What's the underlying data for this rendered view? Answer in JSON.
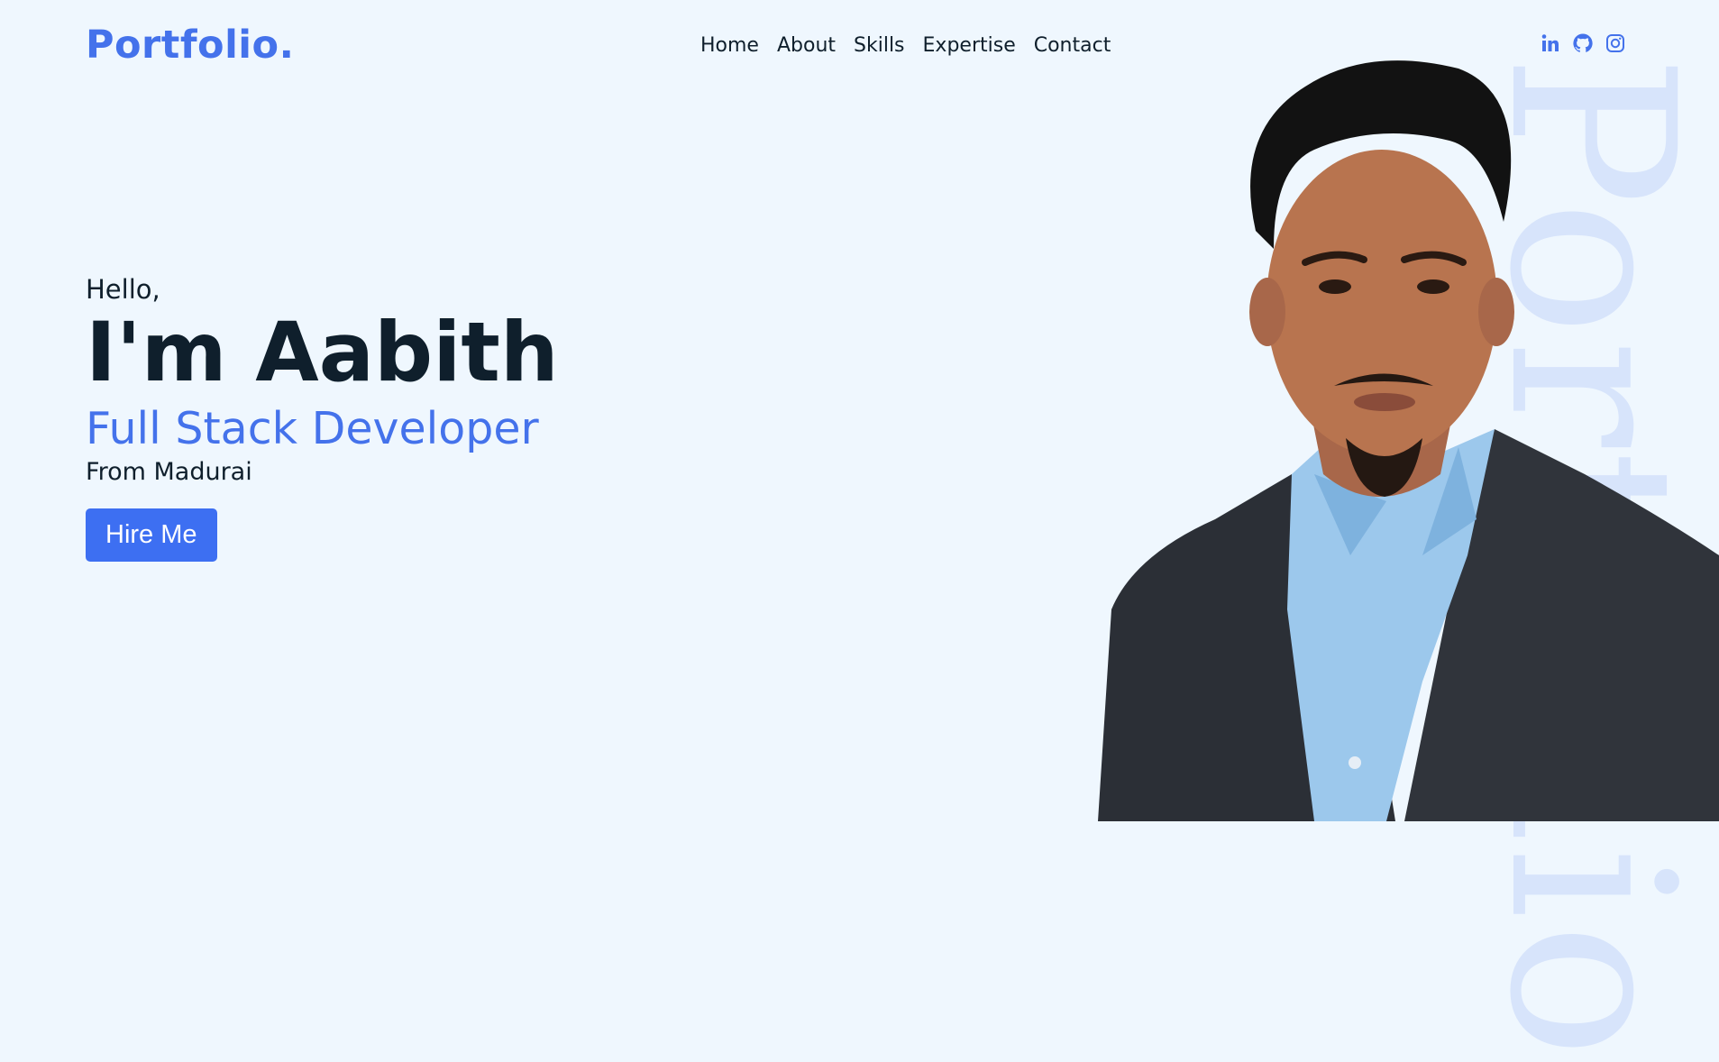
{
  "header": {
    "logo": "Portfolio.",
    "nav": [
      "Home",
      "About",
      "Skills",
      "Expertise",
      "Contact"
    ],
    "socials": [
      "linkedin-icon",
      "github-icon",
      "instagram-icon"
    ]
  },
  "hero": {
    "greeting": "Hello,",
    "name": "I'm Aabith",
    "role": "Full Stack Developer",
    "location": "From Madurai",
    "cta": "Hire Me"
  },
  "background_text": "Portfolio",
  "colors": {
    "accent": "#4472eb",
    "button": "#3d6ff2",
    "background": "#eff7fe",
    "text": "#0f1f2c",
    "watermark": "#d7e4fb"
  }
}
